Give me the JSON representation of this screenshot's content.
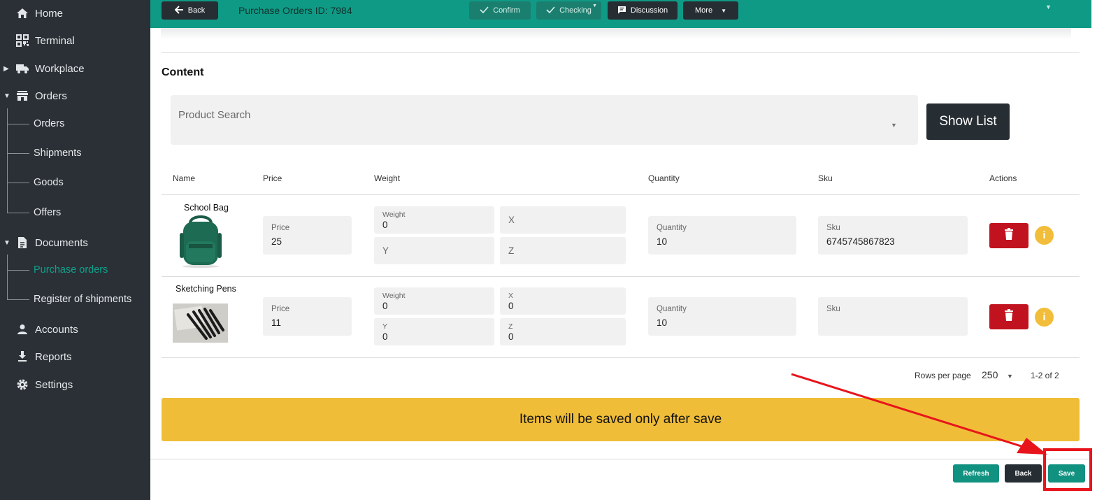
{
  "sidebar": {
    "items": [
      {
        "label": "Home",
        "icon": "home-icon"
      },
      {
        "label": "Terminal",
        "icon": "qr-icon"
      },
      {
        "label": "Workplace",
        "icon": "truck-icon"
      },
      {
        "label": "Orders",
        "icon": "store-icon"
      },
      {
        "label": "Documents",
        "icon": "document-icon"
      },
      {
        "label": "Accounts",
        "icon": "person-icon"
      },
      {
        "label": "Reports",
        "icon": "download-icon"
      },
      {
        "label": "Settings",
        "icon": "gear-icon"
      }
    ],
    "orders_sub": [
      "Orders",
      "Shipments",
      "Goods",
      "Offers"
    ],
    "documents_sub": [
      "Purchase orders",
      "Register of shipments"
    ]
  },
  "header": {
    "back_label": "Back",
    "title": "Purchase Orders ID: 7984",
    "confirm_label": "Confirm",
    "checking_label": "Checking",
    "discussion_label": "Discussion",
    "more_label": "More"
  },
  "content": {
    "title": "Content",
    "search_placeholder": "Product Search",
    "show_list_label": "Show List"
  },
  "table": {
    "headers": [
      "Name",
      "Price",
      "Weight",
      "Quantity",
      "Sku",
      "Actions"
    ],
    "rows": [
      {
        "name": "School Bag",
        "price_label": "Price",
        "price": "25",
        "weight_label": "Weight",
        "weight": "0",
        "x_label": "X",
        "x": "",
        "y_label": "Y",
        "y": "",
        "z_label": "Z",
        "z": "",
        "quantity_label": "Quantity",
        "quantity": "10",
        "sku_label": "Sku",
        "sku": "6745745867823"
      },
      {
        "name": "Sketching Pens",
        "price_label": "Price",
        "price": "11",
        "weight_label": "Weight",
        "weight": "0",
        "x_label": "X",
        "x": "0",
        "y_label": "Y",
        "y": "0",
        "z_label": "Z",
        "z": "0",
        "quantity_label": "Quantity",
        "quantity": "10",
        "sku_label": "Sku",
        "sku": ""
      }
    ],
    "info_glyph": "i"
  },
  "pagination": {
    "rows_per_page_label": "Rows per page",
    "rows_per_page": "250",
    "range": "1-2 of 2"
  },
  "banner": "Items will be saved only after save",
  "footer": {
    "refresh_label": "Refresh",
    "back_label": "Back",
    "save_label": "Save"
  },
  "colors": {
    "sidebar": "#2a3036",
    "accent": "#0f9a86",
    "dark_button": "#262d33",
    "danger": "#c1121f",
    "warning": "#f0bd38",
    "annotation": "#e8141b"
  }
}
